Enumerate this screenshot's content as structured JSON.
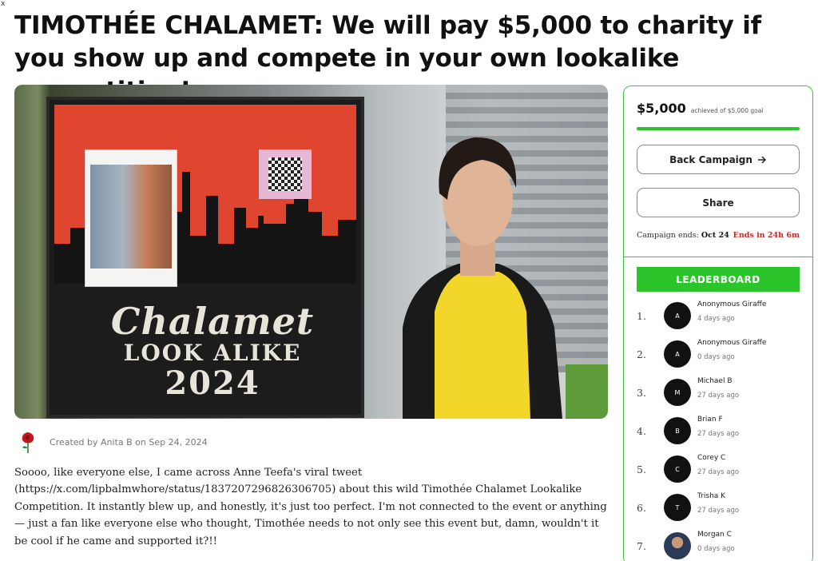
{
  "corner_mark": "x",
  "title": "TIMOTHÉE CHALAMET: We will pay $5,000 to charity if you show up and compete in your own lookalike competition!",
  "hero": {
    "logo_line1": "Chalamet",
    "logo_line2": "LOOK ALIKE",
    "logo_line3": "2024"
  },
  "creator": {
    "text": "Created by Anita B on Sep 24, 2024",
    "avatar_icon": "rose-icon"
  },
  "description": "Soooo, like everyone else, I came across Anne Teefa's viral tweet (https://x.com/lipbalmwhore/status/1837207296826306705) about this wild Timothée Chalamet Lookalike Competition. It instantly blew up, and honestly, it's just too perfect. I'm not connected to the event or anything — just a fan like everyone else who thought, Timothée needs to not only see this event but, damn, wouldn't it be cool if he came and supported it?!!",
  "campaign": {
    "amount": "$5,000",
    "goal_text": "achieved of $5,000 goal",
    "progress_fraction": 1.0,
    "back_label": "Back Campaign",
    "back_icon": "arrow-right-icon",
    "share_label": "Share",
    "ends_label": "Campaign ends:",
    "ends_date": "Oct 24",
    "ends_in": "Ends in 24h 6m",
    "accent_color": "#2bc42b",
    "warn_color": "#c62828"
  },
  "leaderboard": {
    "title": "LEADERBOARD",
    "rows": [
      {
        "rank": "1.",
        "initial": "A",
        "name": "Anonymous Giraffe",
        "when": "4 days ago"
      },
      {
        "rank": "2.",
        "initial": "A",
        "name": "Anonymous Giraffe",
        "when": "0 days ago"
      },
      {
        "rank": "3.",
        "initial": "M",
        "name": "Michael B",
        "when": "27 days ago"
      },
      {
        "rank": "4.",
        "initial": "B",
        "name": "Brian F",
        "when": "27 days ago"
      },
      {
        "rank": "5.",
        "initial": "C",
        "name": "Corey C",
        "when": "27 days ago"
      },
      {
        "rank": "6.",
        "initial": "T",
        "name": "Trisha K",
        "when": "27 days ago"
      },
      {
        "rank": "7.",
        "initial": "",
        "name": "Morgan C",
        "when": "0 days ago"
      }
    ]
  }
}
